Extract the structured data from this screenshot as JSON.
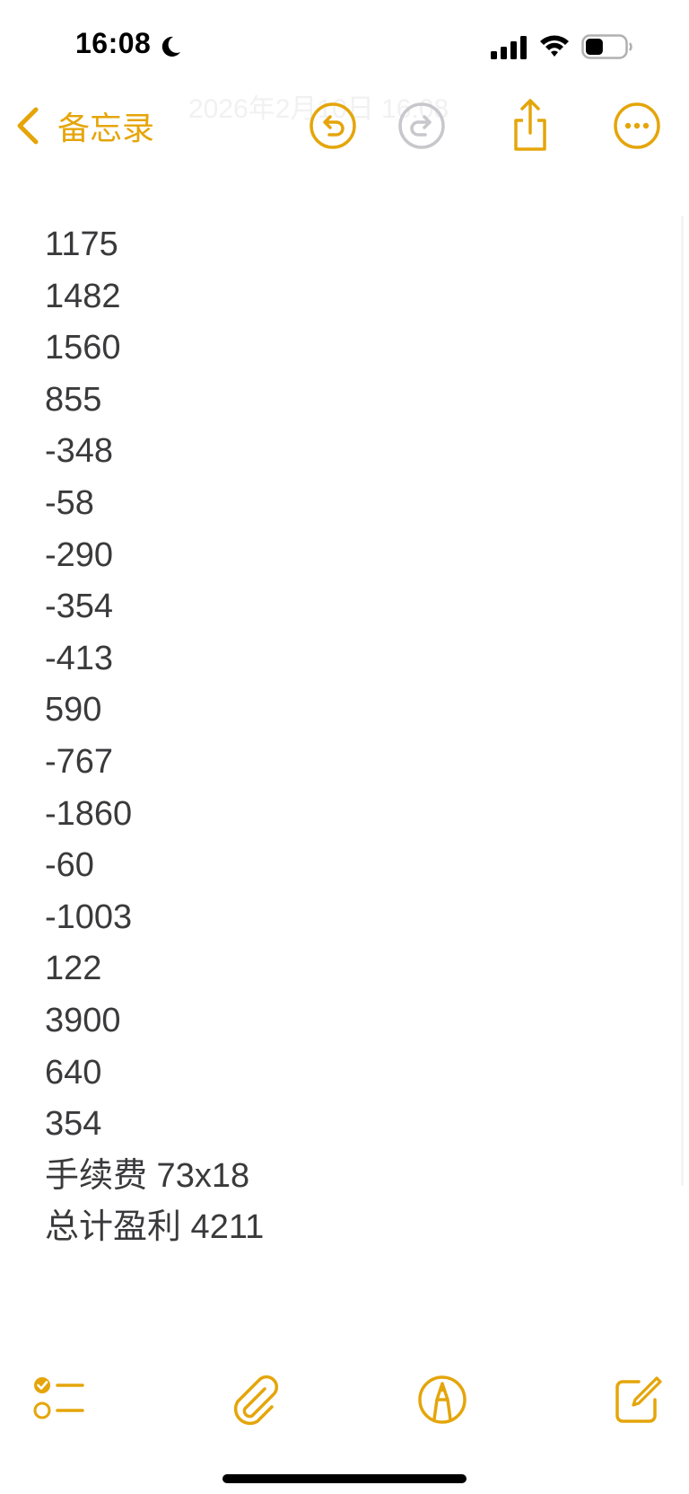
{
  "status_bar": {
    "time": "16:08",
    "moon_icon": "moon-icon",
    "signal_icon": "cellular-signal-icon",
    "wifi_icon": "wifi-icon",
    "battery_icon": "battery-icon",
    "battery_level": 0.45
  },
  "nav": {
    "back_label": "备忘录",
    "ghost_title": "2026年2月10日 16:08",
    "icons": [
      "chevron-left-icon",
      "undo-icon",
      "redo-icon",
      "share-icon",
      "more-icon"
    ]
  },
  "note": {
    "lines": [
      "1175",
      "1482",
      "1560",
      "855",
      "-348",
      "-58",
      "-290",
      "-354",
      "-413",
      "590",
      "-767",
      "-1860",
      "-60",
      "-1003",
      "122",
      "3900",
      "640",
      "354",
      "手续费 73x18",
      "总计盈利 4211"
    ]
  },
  "toolbar": {
    "icons": [
      "checklist-icon",
      "paperclip-icon",
      "markup-pen-icon",
      "compose-icon"
    ]
  },
  "colors": {
    "accent": "#E5A50A",
    "text": "#3A3A3C",
    "disabled": "#C7C7CC"
  }
}
